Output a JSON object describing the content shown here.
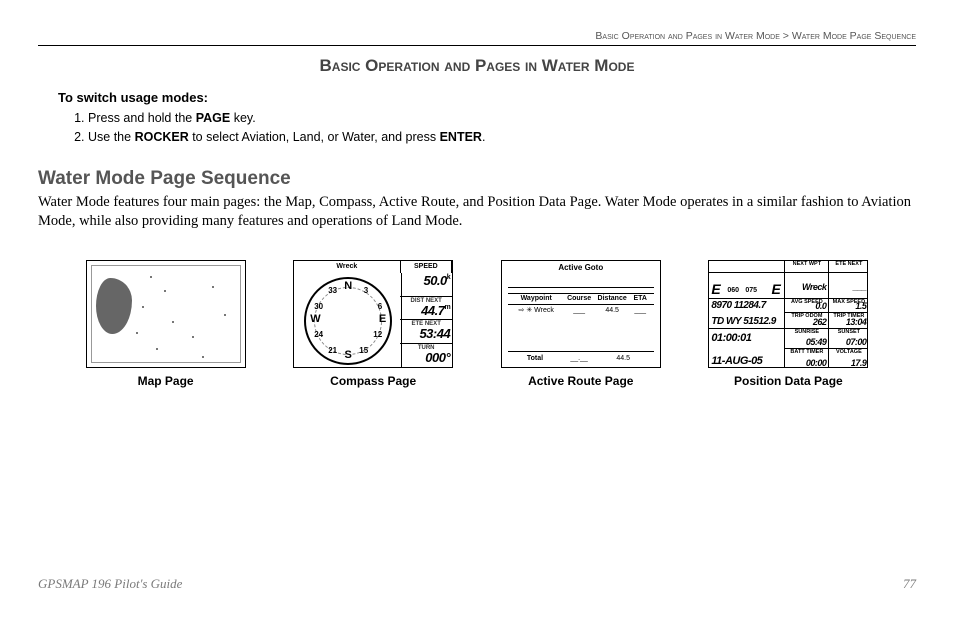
{
  "breadcrumb": {
    "part1": "Basic Operation and Pages in Water Mode",
    "sep": " > ",
    "part2": "Water Mode Page Sequence"
  },
  "title": "Basic Operation and Pages in Water Mode",
  "instructions": {
    "heading": "To switch usage modes:",
    "step1_a": "Press and hold the ",
    "step1_b": "PAGE",
    "step1_c": " key.",
    "step2_a": "Use the ",
    "step2_b": "ROCKER",
    "step2_c": " to select Aviation, Land, or Water, and press ",
    "step2_d": "ENTER",
    "step2_e": "."
  },
  "section_heading": "Water Mode Page Sequence",
  "body": "Water Mode features four main pages: the Map, Compass, Active Route, and Position Data Page. Water Mode operates in a similar fashion to Aviation Mode, while also providing many features and operations of Land Mode.",
  "captions": {
    "map": "Map Page",
    "compass": "Compass Page",
    "route": "Active Route Page",
    "position": "Position Data Page"
  },
  "compass": {
    "top_label_left": "Wreck",
    "top_label_right": "SPEED",
    "speed_val": "50.0",
    "speed_unit": "k",
    "dist_lbl": "DIST NEXT",
    "dist_val": "44.7",
    "dist_unit": "m",
    "ete_lbl": "ETE NEXT",
    "ete_val": "53:44",
    "turn_lbl": "TURN",
    "turn_val": "000°",
    "N": "N",
    "E": "E",
    "S": "S",
    "W": "W",
    "n3": "3",
    "n6": "6",
    "n12": "12",
    "n15": "15",
    "n21": "21",
    "n24": "24",
    "n30": "30",
    "n33": "33"
  },
  "route": {
    "title": "Active Goto",
    "h1": "Waypoint",
    "h2": "Course",
    "h3": "Distance",
    "h4": "ETA",
    "row_wp": "⇨ ✳ Wreck",
    "row_course": "___",
    "row_dist": "44.5",
    "row_eta": "___",
    "total_lbl": "Total",
    "total_course": "__.__",
    "total_dist": "44.5"
  },
  "position": {
    "hdr_wpt": "NEXT WPT",
    "hdr_wpt_val": "Wreck",
    "hdr_ete": "ETE NEXT",
    "hdr_ete_val": "___",
    "tape_060": "060",
    "tape_075": "075",
    "avg_lbl": "AVG SPEED",
    "avg_val": "0.0",
    "max_lbl": "MAX SPEED",
    "max_val": "1.5",
    "coord1": "8970 11284.7",
    "coord2": "TD  WY 51512.9",
    "odom_lbl": "TRIP ODOM",
    "odom_val": "262",
    "ttimer_lbl": "TRIP TIMER",
    "ttimer_val": "13:04",
    "time_val": "01:00:01",
    "date_val": "11-AUG-05",
    "sunrise_lbl": "SUNRISE",
    "sunrise_val": "05:49",
    "sunset_lbl": "SUNSET",
    "sunset_val": "07:00",
    "batt_lbl": "BATT TIMER",
    "batt_val": "00:00",
    "volt_lbl": "VOLTAGE",
    "volt_val": "17.9"
  },
  "footer": {
    "guide": "GPSMAP 196 Pilot's Guide",
    "page": "77"
  }
}
